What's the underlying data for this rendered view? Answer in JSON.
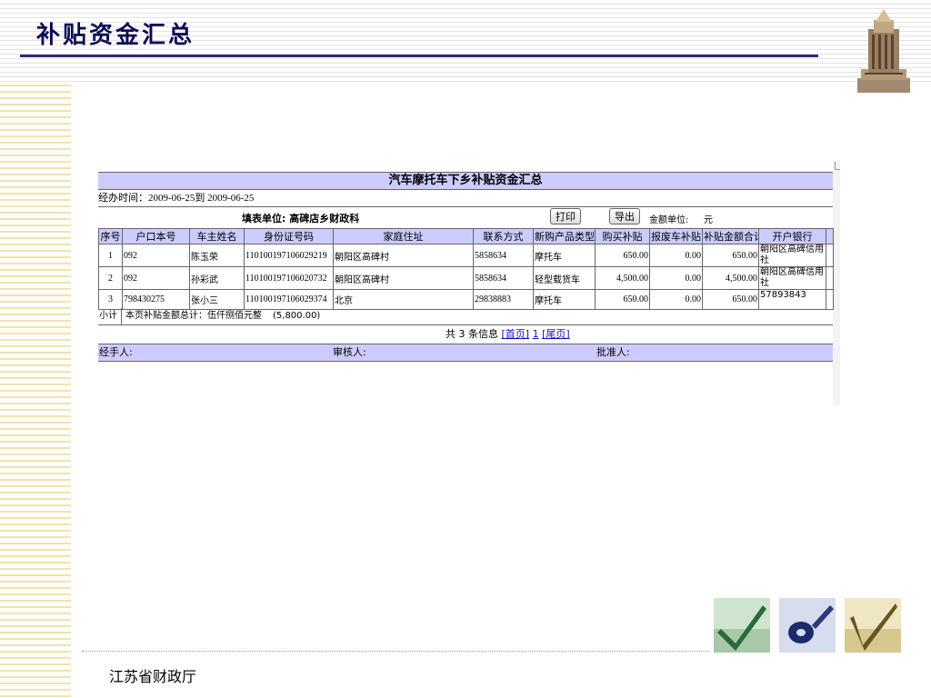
{
  "slide": {
    "title": "补贴资金汇总",
    "footer": "江苏省财政厅"
  },
  "report": {
    "title": "汽车摩托车下乡补贴资金汇总",
    "date_range": "经办时间：2009-06-25到  2009-06-25",
    "fill_unit": "填表单位: 高碑店乡财政科",
    "print_label": "打印",
    "export_label": "导出",
    "amount_unit_label": "金额单位:",
    "amount_unit_value": "元",
    "columns": [
      "序号",
      "户口本号",
      "车主姓名",
      "身份证号码",
      "家庭住址",
      "联系方式",
      "新购产品类型",
      "购买补贴",
      "报废车补贴",
      "补贴金额合计",
      "开户银行"
    ],
    "rows": [
      {
        "no": "1",
        "hukou": "092",
        "name": "陈玉荣",
        "id": "110100197106029219",
        "address": "朝阳区高碑村",
        "phone": "5858634",
        "product": "摩托车",
        "purchase": "650.00",
        "scrap": "0.00",
        "total": "650.00",
        "bank": "朝阳区高碑信用社"
      },
      {
        "no": "2",
        "hukou": "092",
        "name": "孙彩武",
        "id": "110100197106020732",
        "address": "朝阳区高碑村",
        "phone": "5858634",
        "product": "轻型载货车",
        "purchase": "4,500.00",
        "scrap": "0.00",
        "total": "4,500.00",
        "bank": "朝阳区高碑信用社"
      },
      {
        "no": "3",
        "hukou": "798430275",
        "name": "张小三",
        "id": "110100197106029374",
        "address": "北京",
        "phone": "29838883",
        "product": "摩托车",
        "purchase": "650.00",
        "scrap": "0.00",
        "total": "650.00",
        "bank": "57893843"
      }
    ],
    "subtotal_label": "小计",
    "subtotal_text": "本页补贴金额总计：伍仟捌佰元整",
    "subtotal_amount": "(5,800.00)",
    "pager": {
      "prefix": "共 3 条信息",
      "first": "[首页]",
      "page": "1",
      "last": "[尾页]"
    },
    "signatures": {
      "handler": "经手人:",
      "reviewer": "审核人:",
      "approver": "批准人:"
    }
  },
  "colors": {
    "header_bg": "#ccccff",
    "title_color": "#0a0a55",
    "link_color": "#1010c8"
  }
}
